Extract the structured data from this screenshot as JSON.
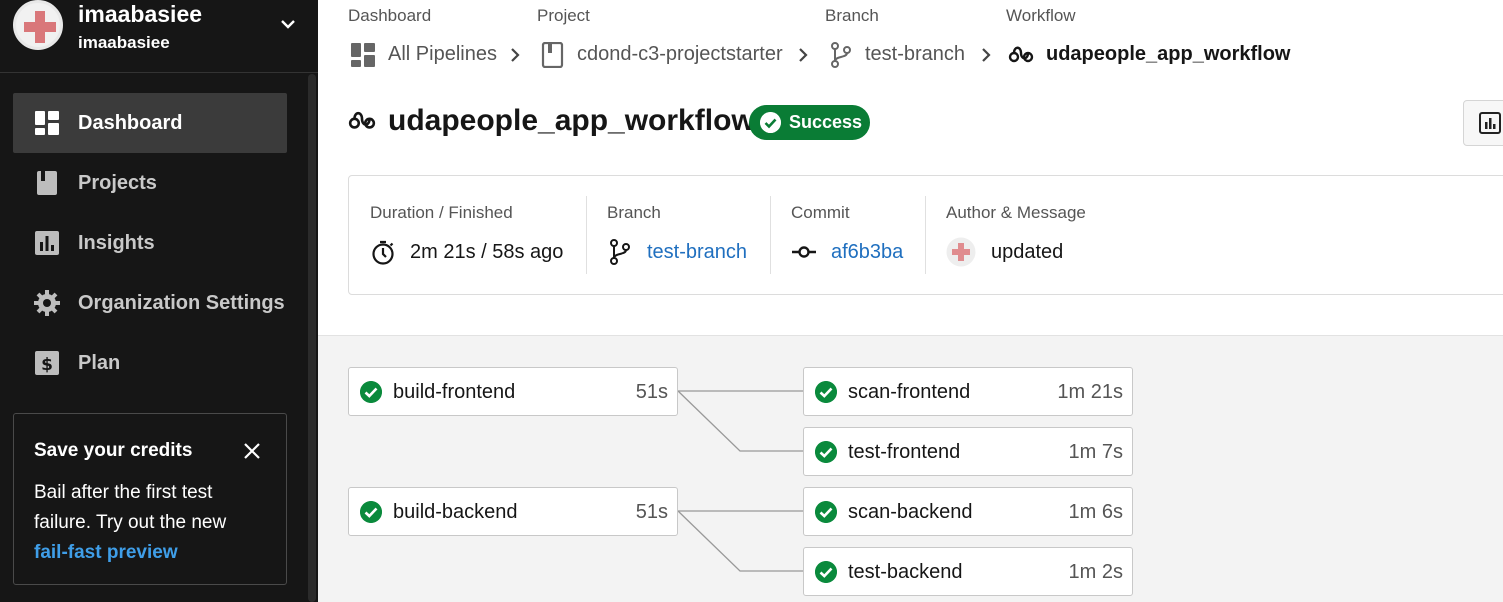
{
  "user": {
    "name": "imaabasiee",
    "org": "imaabasiee"
  },
  "nav": [
    {
      "label": "Dashboard",
      "icon": "dashboard-icon",
      "active": true
    },
    {
      "label": "Projects",
      "icon": "projects-icon",
      "active": false
    },
    {
      "label": "Insights",
      "icon": "insights-icon",
      "active": false
    },
    {
      "label": "Organization Settings",
      "icon": "gear-icon",
      "active": false
    },
    {
      "label": "Plan",
      "icon": "dollar-icon",
      "active": false
    }
  ],
  "promo": {
    "title": "Save your credits",
    "text": "Bail after the first test failure. Try out the new",
    "link": "fail-fast preview"
  },
  "breadcrumb": {
    "dashboard": {
      "label": "Dashboard",
      "value": "All Pipelines"
    },
    "project": {
      "label": "Project",
      "value": "cdond-c3-projectstarter"
    },
    "branch": {
      "label": "Branch",
      "value": "test-branch"
    },
    "workflow": {
      "label": "Workflow",
      "value": "udapeople_app_workflow"
    }
  },
  "workflow": {
    "title": "udapeople_app_workflow",
    "status": "Success",
    "status_color": "#0a7c35"
  },
  "summary": {
    "duration": {
      "label": "Duration / Finished",
      "value": "2m 21s / 58s ago"
    },
    "branch": {
      "label": "Branch",
      "value": "test-branch"
    },
    "commit": {
      "label": "Commit",
      "value": "af6b3ba"
    },
    "author": {
      "label": "Author & Message",
      "value": "updated"
    }
  },
  "jobs": [
    {
      "name": "build-frontend",
      "duration": "51s",
      "status": "success"
    },
    {
      "name": "scan-frontend",
      "duration": "1m 21s",
      "status": "success"
    },
    {
      "name": "test-frontend",
      "duration": "1m 7s",
      "status": "success"
    },
    {
      "name": "build-backend",
      "duration": "51s",
      "status": "success"
    },
    {
      "name": "scan-backend",
      "duration": "1m 6s",
      "status": "success"
    },
    {
      "name": "test-backend",
      "duration": "1m 2s",
      "status": "success"
    }
  ]
}
